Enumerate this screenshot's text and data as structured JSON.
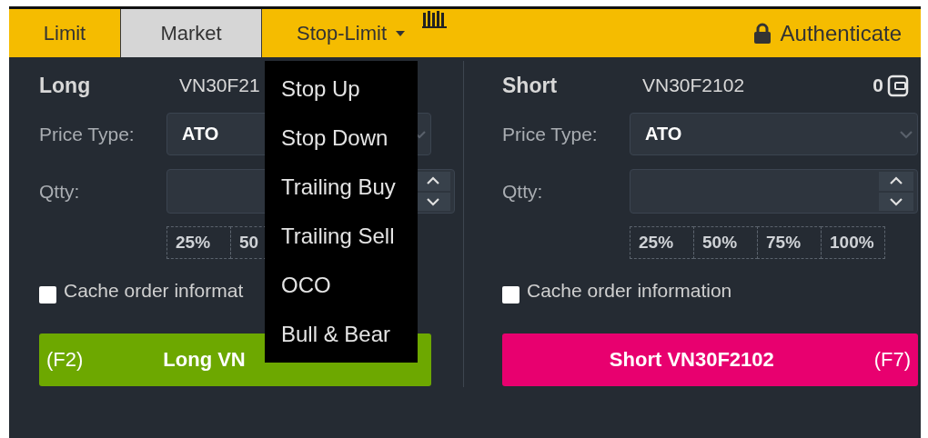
{
  "tabs": [
    {
      "label": "Limit",
      "selected": false,
      "kind": "plain"
    },
    {
      "label": "Market",
      "selected": true,
      "kind": "plain"
    },
    {
      "label": "Stop-Limit",
      "selected": false,
      "kind": "dropdown",
      "expanded": true
    }
  ],
  "menu": [
    {
      "label": "Stop Up"
    },
    {
      "label": "Stop Down"
    },
    {
      "label": "Trailing Buy"
    },
    {
      "label": "Trailing Sell"
    },
    {
      "label": "OCO"
    },
    {
      "label": "Bull & Bear"
    }
  ],
  "auth": {
    "label": "Authenticate"
  },
  "panels": [
    {
      "kind": "long",
      "title": "Long",
      "symbol": "VN30F21",
      "price_type_label": "Price Type:",
      "price_type": "ATO",
      "qty_label": "Qtty:",
      "percents": [
        "25%",
        "50"
      ],
      "cache": {
        "label": "Cache order informat",
        "checked": false
      },
      "action": {
        "key": "(F2)",
        "label": "Long VN"
      }
    },
    {
      "kind": "short",
      "title": "Short",
      "symbol": "VN30F2102",
      "balance": "0",
      "price_type_label": "Price Type:",
      "price_type": "ATO",
      "qty_label": "Qtty:",
      "percents": [
        "25%",
        "50%",
        "75%",
        "100%"
      ],
      "cache": {
        "label": "Cache order information",
        "checked": false
      },
      "action": {
        "key": "(F7)",
        "label": "Short VN30F2102"
      }
    }
  ]
}
